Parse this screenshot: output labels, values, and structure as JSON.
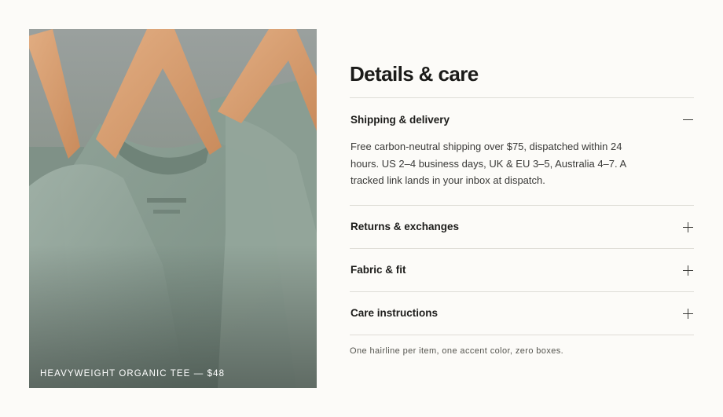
{
  "photo": {
    "alt": "Green t-shirts on wooden hangers",
    "caption": "HEAVYWEIGHT ORGANIC TEE — $48"
  },
  "details": {
    "title": "Details & care",
    "items": [
      {
        "label": "Shipping & delivery",
        "state": "expanded",
        "icon": "minus-icon",
        "body": "Free carbon-neutral shipping over $75, dispatched within 24 hours. US 2–4 business days, UK & EU 3–5, Australia 4–7. A tracked link lands in your inbox at dispatch."
      },
      {
        "label": "Returns & exchanges",
        "state": "collapsed",
        "icon": "plus-icon"
      },
      {
        "label": "Fabric & fit",
        "state": "collapsed",
        "icon": "plus-icon"
      },
      {
        "label": "Care instructions",
        "state": "collapsed",
        "icon": "plus-icon"
      }
    ],
    "footnote": "One hairline per item, one accent color, zero boxes."
  },
  "colors": {
    "background": "#fcfbf8",
    "text": "#1c1c1a",
    "hairline": "#dedcd6",
    "shirt": "#8fa096",
    "hanger": "#d39a6e"
  }
}
